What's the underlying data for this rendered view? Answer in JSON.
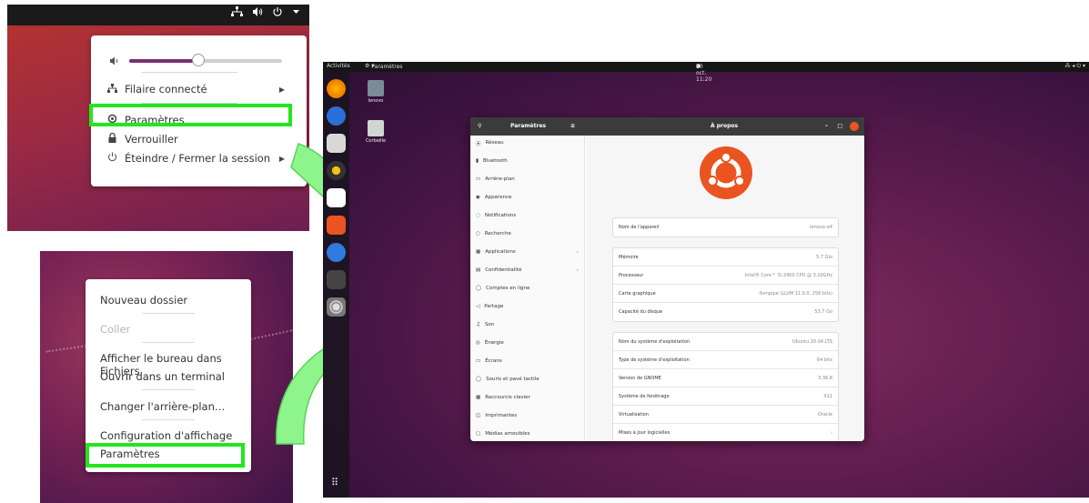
{
  "system_menu": {
    "network_label": "Filaire connecté",
    "settings_label": "Paramètres",
    "lock_label": "Verrouiller",
    "power_label": "Éteindre / Fermer la session",
    "volume": 0.45
  },
  "desktop_menu": {
    "new_folder": "Nouveau dossier",
    "paste": "Coller",
    "show_in_files": "Afficher le bureau dans Fichiers",
    "open_terminal": "Ouvrir dans un terminal",
    "change_background": "Changer l'arrière-plan…",
    "display_settings": "Configuration d'affichage",
    "settings": "Paramètres"
  },
  "desktop": {
    "activities": "Activités",
    "app_menu": "Paramètres",
    "clock": "20 oct. 11:20",
    "home_icon_label": "lenovo",
    "trash_icon_label": "Corbeille"
  },
  "settings_window": {
    "sidebar_title": "Paramètres",
    "page_title": "À propos",
    "sidebar_items": [
      "Réseau",
      "Bluetooth",
      "Arrière-plan",
      "Apparence",
      "Notifications",
      "Recherche",
      "Applications",
      "Confidentialité",
      "Comptes en ligne",
      "Partage",
      "Son",
      "Énergie",
      "Écrans",
      "Souris et pavé tactile",
      "Raccourcis clavier",
      "Imprimantes",
      "Médias amovibles"
    ],
    "device_name_label": "Nom de l'appareil",
    "device_name_value": "lenovo-a4",
    "hardware": [
      {
        "k": "Mémoire",
        "v": "5,7 Gio"
      },
      {
        "k": "Processeur",
        "v": "Intel® Core™ i5-2400 CPU @ 3.10GHz"
      },
      {
        "k": "Carte graphique",
        "v": "llvmpipe (LLVM 11.0.0, 256 bits)"
      },
      {
        "k": "Capacité du disque",
        "v": "53,7 Go"
      }
    ],
    "os": [
      {
        "k": "Nom du système d'exploitation",
        "v": "Ubuntu 20.04 LTS"
      },
      {
        "k": "Type de système d'exploitation",
        "v": "64 bits"
      },
      {
        "k": "Version de GNOME",
        "v": "3.36.8"
      },
      {
        "k": "Système de fenêtrage",
        "v": "X11"
      },
      {
        "k": "Virtualisation",
        "v": "Oracle"
      },
      {
        "k": "Mises à jour logicielles",
        "v": ""
      }
    ]
  }
}
